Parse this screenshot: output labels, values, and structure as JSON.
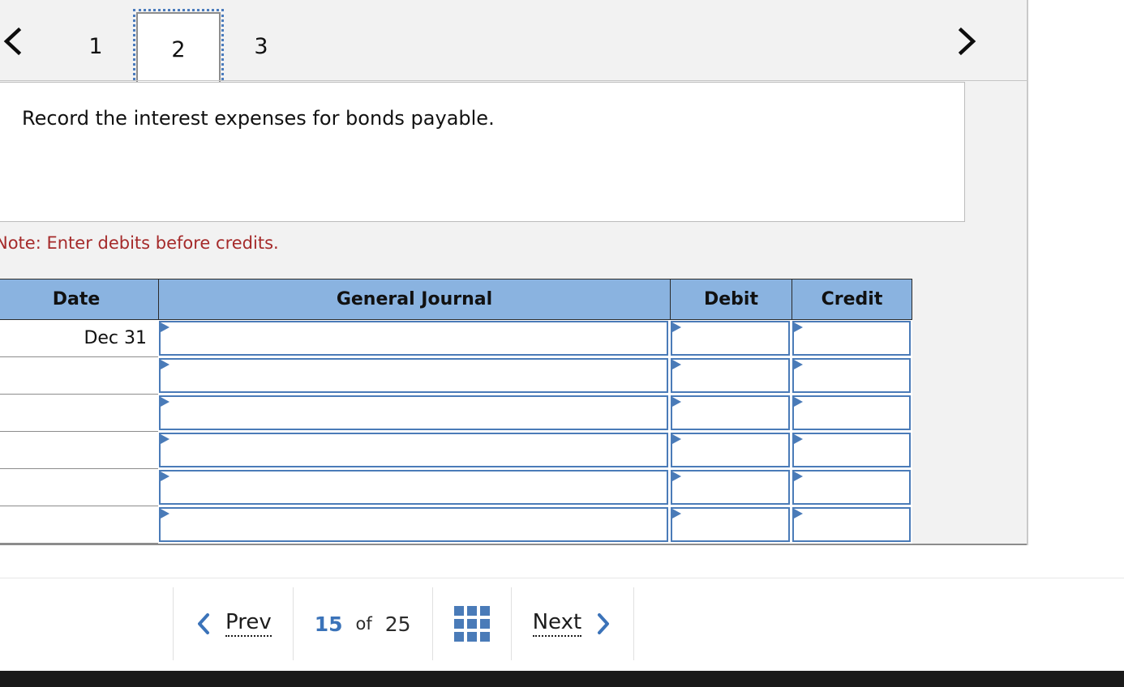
{
  "tabs": {
    "prev_icon": "chevron-left-icon",
    "next_icon": "chevron-right-icon",
    "items": [
      {
        "label": "1",
        "selected": false
      },
      {
        "label": "2",
        "selected": true
      },
      {
        "label": "3",
        "selected": false
      }
    ]
  },
  "prompt": {
    "text": "Record the interest expenses for bonds payable."
  },
  "note": {
    "text": "Note: Enter debits before credits."
  },
  "journal": {
    "headers": {
      "date": "Date",
      "general_journal": "General Journal",
      "debit": "Debit",
      "credit": "Credit"
    },
    "rows": [
      {
        "date": "Dec 31",
        "general_journal": "",
        "debit": "",
        "credit": ""
      },
      {
        "date": "",
        "general_journal": "",
        "debit": "",
        "credit": ""
      },
      {
        "date": "",
        "general_journal": "",
        "debit": "",
        "credit": ""
      },
      {
        "date": "",
        "general_journal": "",
        "debit": "",
        "credit": ""
      },
      {
        "date": "",
        "general_journal": "",
        "debit": "",
        "credit": ""
      },
      {
        "date": "",
        "general_journal": "",
        "debit": "",
        "credit": ""
      }
    ]
  },
  "pager": {
    "prev_label": "Prev",
    "next_label": "Next",
    "prev_icon": "chevron-left-icon",
    "next_icon": "chevron-right-icon",
    "grid_icon": "grid-view-icon",
    "current_page": "15",
    "of_label": "of",
    "total_pages": "25"
  },
  "colors": {
    "panel_bg": "#f2f2f2",
    "header_blue": "#8ab3e0",
    "input_border_blue": "#4a7bb8",
    "accent_blue": "#3b73b9",
    "note_red": "#a52a2a",
    "bottom_bar": "#1a1a1a"
  }
}
